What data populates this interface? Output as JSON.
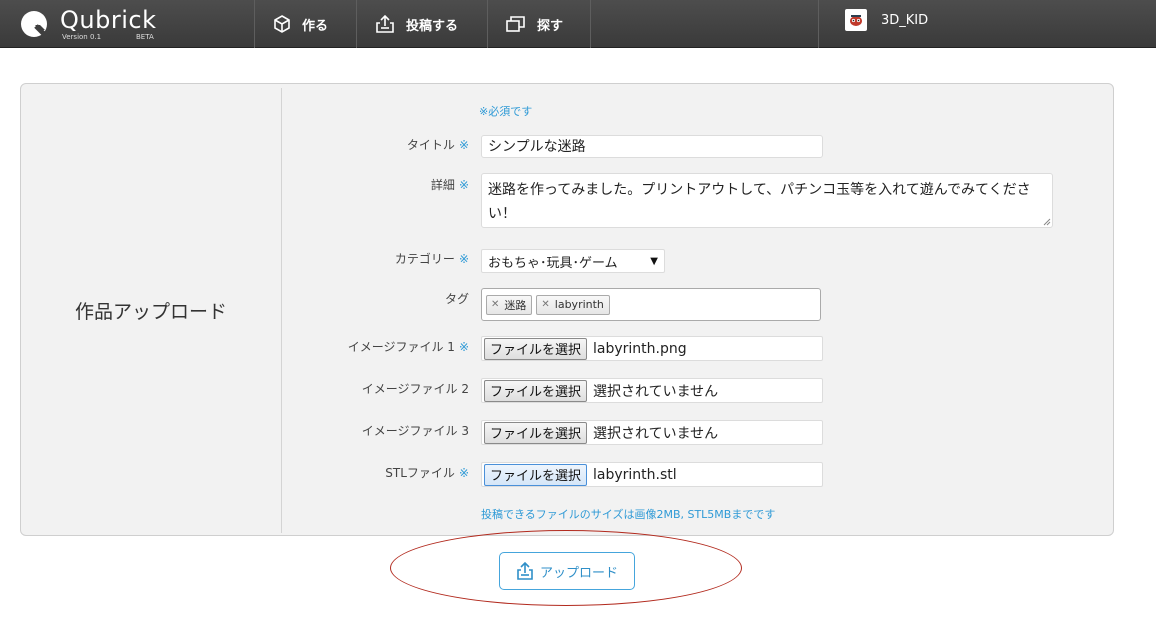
{
  "header": {
    "logo_name": "Qubrick",
    "logo_version": "Version 0.1",
    "logo_beta": "BETA",
    "nav": [
      {
        "label": "作る",
        "icon": "cube-icon"
      },
      {
        "label": "投稿する",
        "icon": "upload-tray-icon"
      },
      {
        "label": "探す",
        "icon": "cards-icon"
      }
    ],
    "user_name": "3D_KID"
  },
  "panel": {
    "title": "作品アップロード",
    "required_note": "※必須です",
    "required_mark": "※",
    "fields": {
      "title": {
        "label": "タイトル",
        "value": "シンプルな迷路"
      },
      "detail": {
        "label": "詳細",
        "value": "迷路を作ってみました。プリントアウトして、パチンコ玉等を入れて遊んでみてください！"
      },
      "category": {
        "label": "カテゴリー",
        "value": "おもちゃ･玩具･ゲーム"
      },
      "tags": {
        "label": "タグ",
        "items": [
          "迷路",
          "labyrinth"
        ]
      },
      "image1": {
        "label": "イメージファイル 1",
        "value": "labyrinth.png"
      },
      "image2": {
        "label": "イメージファイル 2",
        "value": "選択されていません"
      },
      "image3": {
        "label": "イメージファイル 3",
        "value": "選択されていません"
      },
      "stl": {
        "label": "STLファイル",
        "value": "labyrinth.stl"
      }
    },
    "file_button_label": "ファイルを選択",
    "size_note": "投稿できるファイルのサイズは画像2MB, STL5MBまでです"
  },
  "upload_button": {
    "label": "アップロード"
  },
  "colors": {
    "accent": "#2f9ad6",
    "header_bg": "#444444",
    "highlight": "#b22a1e"
  }
}
